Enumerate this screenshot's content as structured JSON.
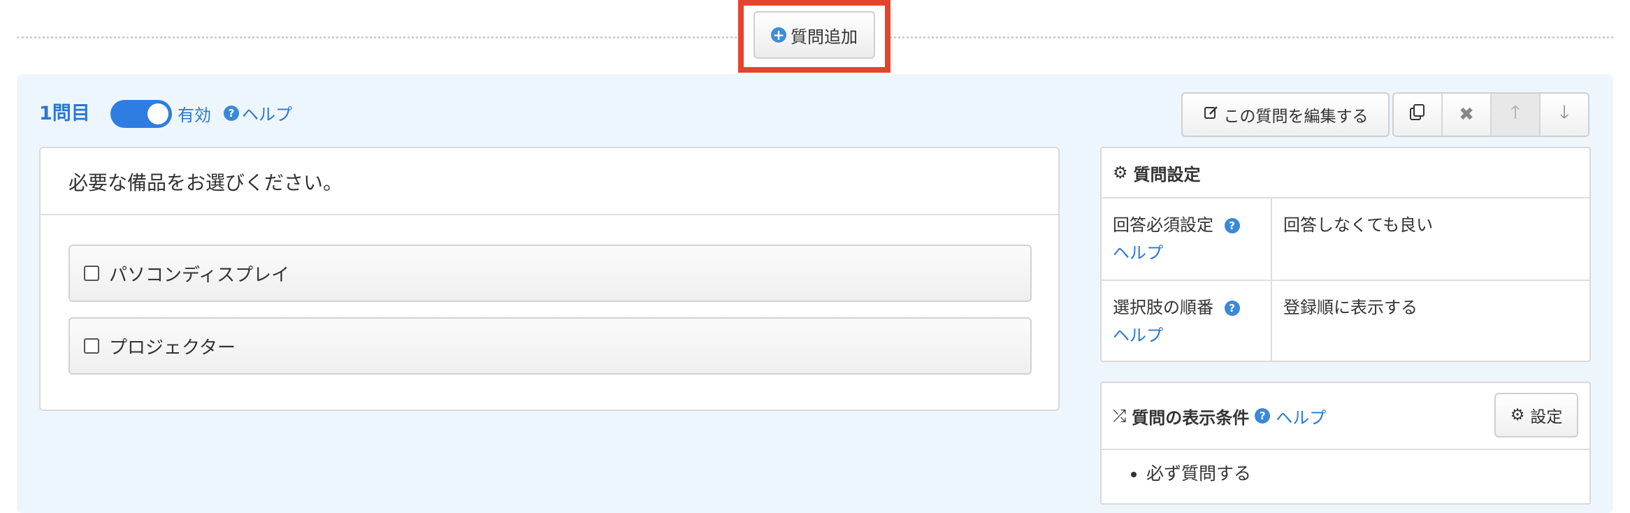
{
  "toolbar": {
    "add_question_label": "質問追加"
  },
  "question": {
    "number_label": "1問目",
    "enabled_label": "有効",
    "help_label": "ヘルプ",
    "edit_label": "この質問を編集する",
    "text": "必要な備品をお選びください。",
    "options": [
      {
        "label": "パソコンディスプレイ"
      },
      {
        "label": "プロジェクター"
      }
    ]
  },
  "actions": {
    "copy_icon": "copy-icon",
    "delete_icon": "times-icon",
    "up_icon": "arrow-up-icon",
    "down_icon": "arrow-down-icon"
  },
  "settings": {
    "title": "質問設定",
    "rows": [
      {
        "key": "回答必須設定",
        "help": "ヘルプ",
        "value": "回答しなくても良い"
      },
      {
        "key": "選択肢の順番",
        "help": "ヘルプ",
        "value": "登録順に表示する"
      }
    ]
  },
  "conditions": {
    "title": "質問の表示条件",
    "help_label": "ヘルプ",
    "settings_button": "設定",
    "items": [
      "必ず質問する"
    ]
  },
  "colors": {
    "accent": "#2a78d1",
    "highlight": "#e5432c",
    "panel_bg": "#eef6fd"
  }
}
